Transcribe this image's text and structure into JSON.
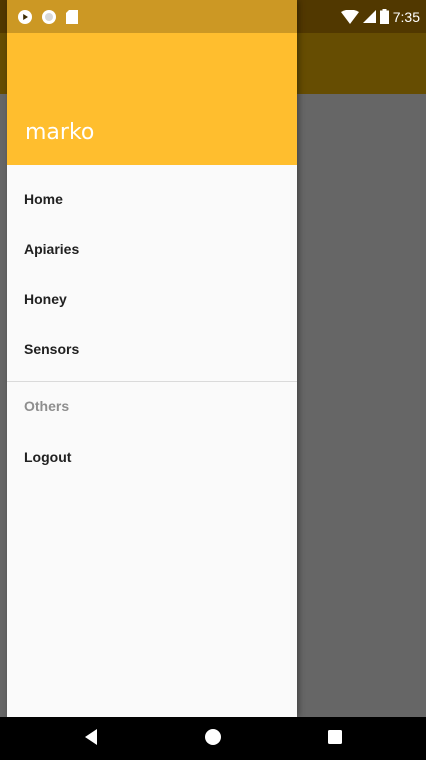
{
  "status_bar": {
    "time": "7:35",
    "left_icons": [
      "play-notification-icon",
      "circle-notification-icon",
      "sd-card-icon"
    ],
    "right_icons": [
      "wifi-icon",
      "cell-signal-icon",
      "battery-icon"
    ]
  },
  "drawer": {
    "username": "marko",
    "header_color": "#FFBE2E",
    "items": [
      {
        "label": "Home"
      },
      {
        "label": "Apiaries"
      },
      {
        "label": "Honey"
      },
      {
        "label": "Sensors"
      }
    ],
    "section_title": "Others",
    "logout_label": "Logout"
  },
  "nav_bar": {
    "buttons": [
      "back-icon",
      "home-icon",
      "recents-icon"
    ]
  },
  "colors": {
    "accent": "#FFC107",
    "scrim": "#000000"
  }
}
